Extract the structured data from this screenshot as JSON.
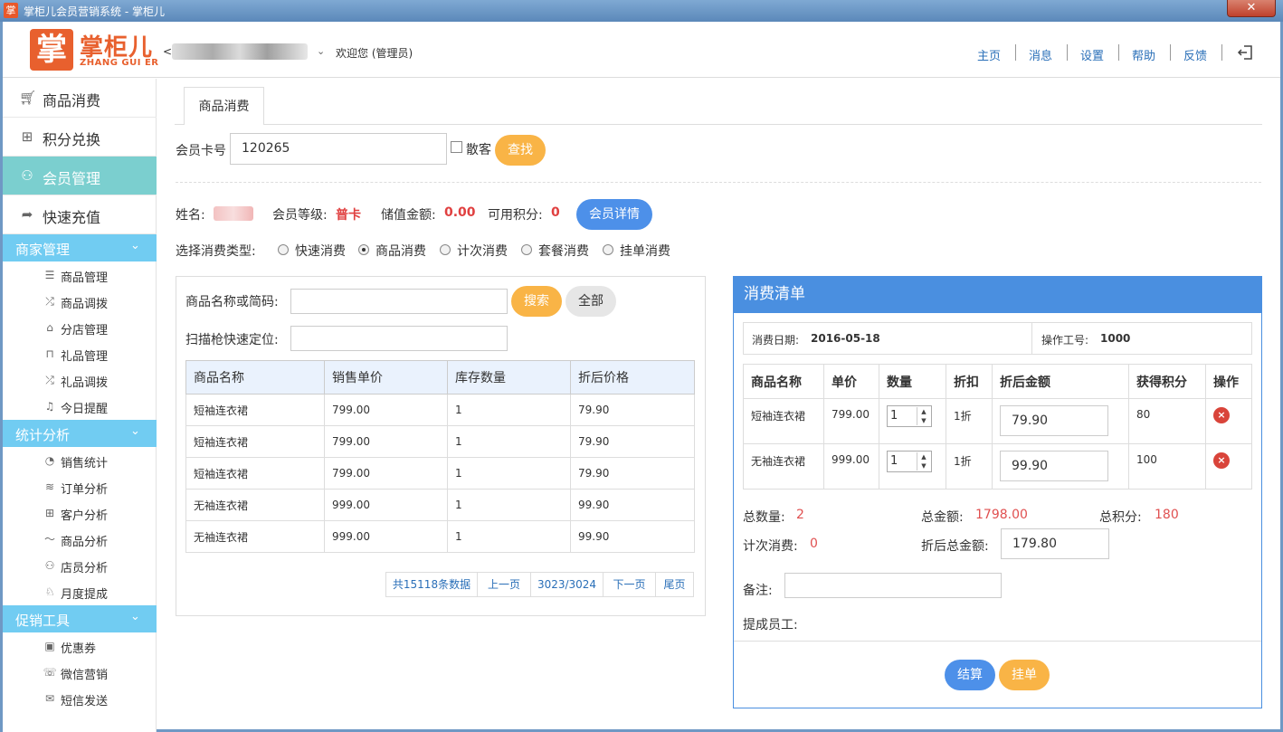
{
  "window": {
    "title": "掌柜儿会员营销系统 - 掌柜儿",
    "icon_char": "掌",
    "close_label": "✕"
  },
  "header": {
    "logo_char": "掌",
    "logo_text": "掌柜儿",
    "logo_sub": "ZHANG GUI ER",
    "store_prefix": "<",
    "welcome": "欢迎您 (管理员)",
    "nav": [
      "主页",
      "消息",
      "设置",
      "帮助",
      "反馈"
    ]
  },
  "sidebar": {
    "main_items": [
      {
        "label": "商品消费",
        "icon": "cart-icon"
      },
      {
        "label": "积分兑换",
        "icon": "gift-icon"
      },
      {
        "label": "会员管理",
        "icon": "member-icon",
        "active": true
      },
      {
        "label": "快速充值",
        "icon": "share-icon"
      }
    ],
    "groups": [
      {
        "label": "商家管理",
        "items": [
          {
            "label": "商品管理",
            "icon": "list-icon"
          },
          {
            "label": "商品调拨",
            "icon": "shuffle-icon"
          },
          {
            "label": "分店管理",
            "icon": "home-icon"
          },
          {
            "label": "礼品管理",
            "icon": "lock-icon"
          },
          {
            "label": "礼品调拨",
            "icon": "shuffle-icon"
          },
          {
            "label": "今日提醒",
            "icon": "bell-icon"
          }
        ]
      },
      {
        "label": "统计分析",
        "items": [
          {
            "label": "销售统计",
            "icon": "pie-icon"
          },
          {
            "label": "订单分析",
            "icon": "layers-icon"
          },
          {
            "label": "客户分析",
            "icon": "grid-icon"
          },
          {
            "label": "商品分析",
            "icon": "trend-icon"
          },
          {
            "label": "店员分析",
            "icon": "user-icon"
          },
          {
            "label": "月度提成",
            "icon": "award-icon"
          }
        ]
      },
      {
        "label": "促销工具",
        "items": [
          {
            "label": "优惠券",
            "icon": "coupon-icon"
          },
          {
            "label": "微信营销",
            "icon": "chat-icon"
          },
          {
            "label": "短信发送",
            "icon": "mail-icon"
          }
        ]
      }
    ]
  },
  "main": {
    "tab": "商品消费",
    "card_label": "会员卡号",
    "card_value": "120265",
    "walkin_label": "散客",
    "find_button": "查找",
    "member": {
      "name_label": "姓名:",
      "level_label": "会员等级:",
      "level_value": "普卡",
      "balance_label": "储值金额:",
      "balance_value": "0.00",
      "points_label": "可用积分:",
      "points_value": "0",
      "detail_button": "会员详情"
    },
    "type_label": "选择消费类型:",
    "types": [
      {
        "label": "快速消费",
        "checked": false
      },
      {
        "label": "商品消费",
        "checked": true
      },
      {
        "label": "计次消费",
        "checked": false
      },
      {
        "label": "套餐消费",
        "checked": false
      },
      {
        "label": "挂单消费",
        "checked": false
      }
    ],
    "search_label": "商品名称或简码:",
    "scan_label": "扫描枪快速定位:",
    "search_button": "搜索",
    "all_button": "全部",
    "product_headers": [
      "商品名称",
      "销售单价",
      "库存数量",
      "折后价格"
    ],
    "products": [
      [
        "短袖连衣裙",
        "799.00",
        "1",
        "79.90"
      ],
      [
        "短袖连衣裙",
        "799.00",
        "1",
        "79.90"
      ],
      [
        "短袖连衣裙",
        "799.00",
        "1",
        "79.90"
      ],
      [
        "无袖连衣裙",
        "999.00",
        "1",
        "99.90"
      ],
      [
        "无袖连衣裙",
        "999.00",
        "1",
        "99.90"
      ]
    ],
    "pager": {
      "total": "共15118条数据",
      "prev": "上一页",
      "page": "3023/3024",
      "next": "下一页",
      "last": "尾页"
    }
  },
  "order": {
    "title": "消费清单",
    "date_label": "消费日期:",
    "date_value": "2016-05-18",
    "operator_label": "操作工号:",
    "operator_value": "1000",
    "headers": [
      "商品名称",
      "单价",
      "数量",
      "折扣",
      "折后金额",
      "获得积分",
      "操作"
    ],
    "rows": [
      {
        "name": "短袖连衣裙",
        "price": "799.00",
        "qty": "1",
        "discount": "1折",
        "amount": "79.90",
        "points": "80"
      },
      {
        "name": "无袖连衣裙",
        "price": "999.00",
        "qty": "1",
        "discount": "1折",
        "amount": "99.90",
        "points": "100"
      }
    ],
    "total_qty_label": "总数量:",
    "total_qty": "2",
    "total_amount_label": "总金额:",
    "total_amount": "1798.00",
    "total_points_label": "总积分:",
    "total_points": "180",
    "count_label": "计次消费:",
    "count_value": "0",
    "discount_total_label": "折后总金额:",
    "discount_total": "179.80",
    "remark_label": "备注:",
    "staff_label": "提成员工:",
    "settle_button": "结算",
    "hold_button": "挂单"
  },
  "colors": {
    "accent_blue": "#4a8fe0",
    "orange": "#f9b446",
    "teal": "#7bcfcf",
    "sky": "#71ccf2",
    "logo": "#e8602e"
  }
}
